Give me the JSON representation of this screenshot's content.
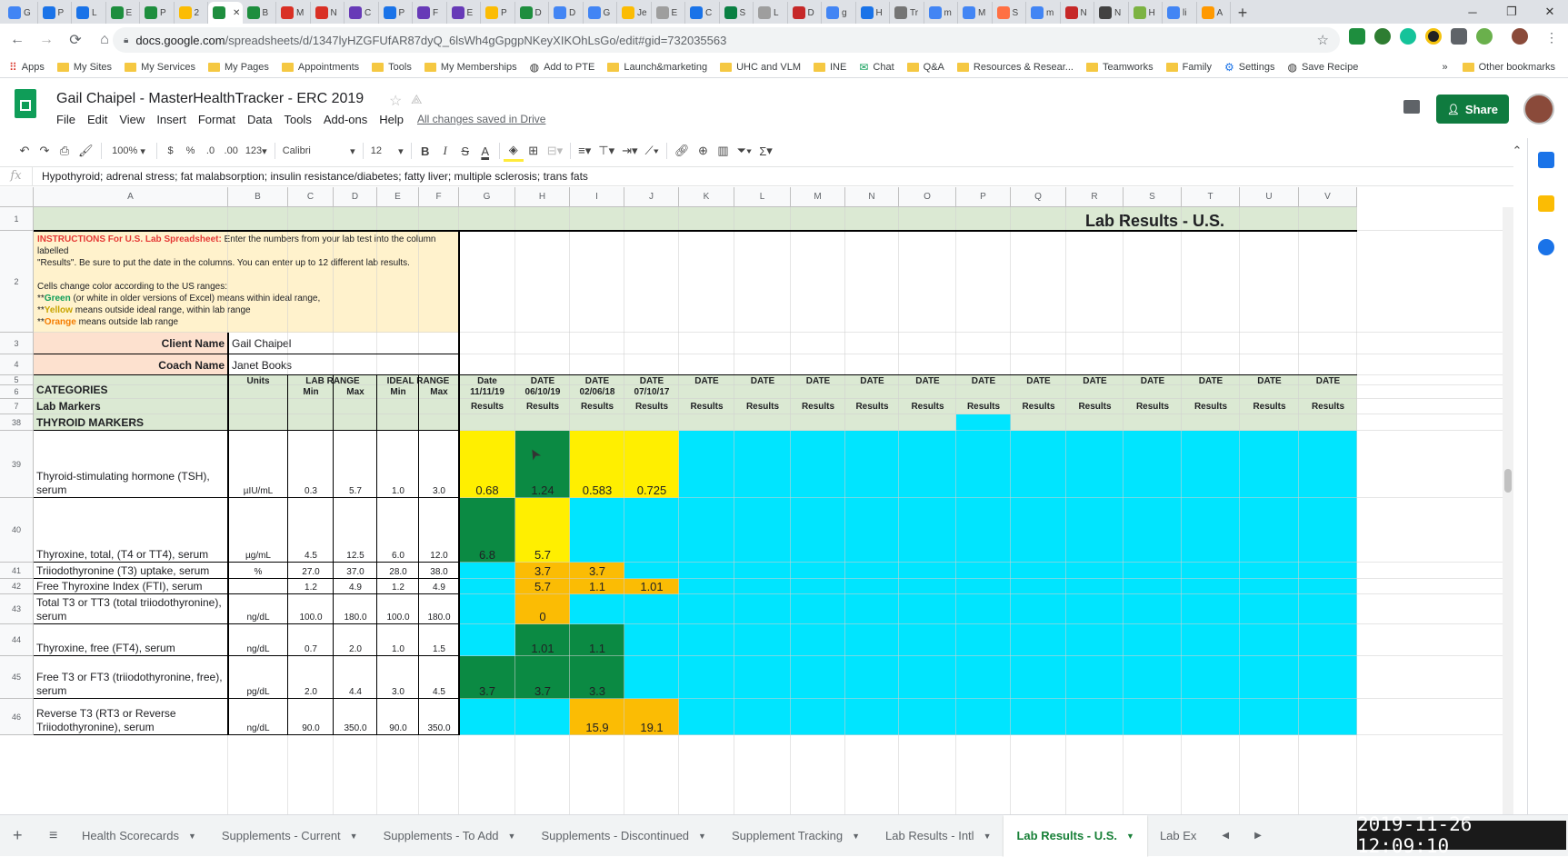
{
  "browser": {
    "tabs": [
      {
        "label": "G",
        "color": "#4285f4",
        "icon": "calendar-icon"
      },
      {
        "label": "P",
        "color": "#1a73e8",
        "icon": "meet-icon"
      },
      {
        "label": "L",
        "color": "#1a73e8",
        "icon": "meet-icon"
      },
      {
        "label": "E",
        "color": "#1e8e3e",
        "icon": "sheets-icon"
      },
      {
        "label": "P",
        "color": "#1e8e3e",
        "icon": "sheets-icon"
      },
      {
        "label": "2",
        "color": "#fbbc04",
        "icon": "drive-icon"
      },
      {
        "label": "",
        "color": "#1e8e3e",
        "icon": "sheets-icon",
        "active": true
      },
      {
        "label": "B",
        "color": "#1e8e3e",
        "icon": "sheets-icon"
      },
      {
        "label": "M",
        "color": "#d93025",
        "icon": "pdf-icon"
      },
      {
        "label": "N",
        "color": "#d93025",
        "icon": "pdf-icon"
      },
      {
        "label": "C",
        "color": "#673ab7",
        "icon": "forms-icon"
      },
      {
        "label": "P",
        "color": "#1a73e8",
        "icon": "meet-icon"
      },
      {
        "label": "F",
        "color": "#673ab7",
        "icon": "forms-icon"
      },
      {
        "label": "E",
        "color": "#673ab7",
        "icon": "forms-icon"
      },
      {
        "label": "P",
        "color": "#fbbc04",
        "icon": "drive-icon"
      },
      {
        "label": "D",
        "color": "#1e8e3e",
        "icon": "sheets-icon"
      },
      {
        "label": "D",
        "color": "#4285f4",
        "icon": "docs-icon"
      },
      {
        "label": "G",
        "color": "#4285f4",
        "icon": "calendar-icon"
      },
      {
        "label": "Je",
        "color": "#fbbc04",
        "icon": "drive-icon"
      },
      {
        "label": "E",
        "color": "#9e9e9e",
        "icon": "image-icon"
      },
      {
        "label": "C",
        "color": "#1a73e8",
        "icon": "link-icon"
      },
      {
        "label": "S",
        "color": "#0a8043",
        "icon": "k-icon"
      },
      {
        "label": "L",
        "color": "#9e9e9e",
        "icon": "image-icon"
      },
      {
        "label": "D",
        "color": "#c62828",
        "icon": "bars-icon"
      },
      {
        "label": "g",
        "color": "#4285f4",
        "icon": "google-icon"
      },
      {
        "label": "H",
        "color": "#1a73e8",
        "icon": "moon-icon"
      },
      {
        "label": "Tr",
        "color": "#757575",
        "icon": "hand-icon"
      },
      {
        "label": "m",
        "color": "#4285f4",
        "icon": "google-icon"
      },
      {
        "label": "M",
        "color": "#4285f4",
        "icon": "google-icon"
      },
      {
        "label": "S",
        "color": "#ff7043",
        "icon": "e-icon"
      },
      {
        "label": "m",
        "color": "#4285f4",
        "icon": "google-icon"
      },
      {
        "label": "N",
        "color": "#c62828",
        "icon": "image-icon"
      },
      {
        "label": "N",
        "color": "#424242",
        "icon": "circle-icon"
      },
      {
        "label": "H",
        "color": "#7cb342",
        "icon": "sheet-icon"
      },
      {
        "label": "li",
        "color": "#4285f4",
        "icon": "google-icon"
      },
      {
        "label": "A",
        "color": "#ff9900",
        "icon": "amazon-icon"
      }
    ],
    "new_tab": "+",
    "minimize": "─",
    "maximize": "❐",
    "close": "✕",
    "url_host": "docs.google.com",
    "url_path": "/spreadsheets/d/1347lyHZGFUfAR87dyQ_6lsWh4gGpgpNKeyXIKOhLsGo/edit#gid=732035563",
    "bookmarks": [
      {
        "label": "Apps",
        "icon": "apps-icon"
      },
      {
        "label": "My Sites",
        "icon": "folder-icon"
      },
      {
        "label": "My Services",
        "icon": "folder-icon"
      },
      {
        "label": "My Pages",
        "icon": "folder-icon"
      },
      {
        "label": "Appointments",
        "icon": "folder-icon"
      },
      {
        "label": "Tools",
        "icon": "folder-icon"
      },
      {
        "label": "My Memberships",
        "icon": "folder-icon"
      },
      {
        "label": "Add to PTE",
        "icon": "globe-icon"
      },
      {
        "label": "Launch&marketing",
        "icon": "folder-icon"
      },
      {
        "label": "UHC and VLM",
        "icon": "folder-icon"
      },
      {
        "label": "INE",
        "icon": "folder-icon"
      },
      {
        "label": "Chat",
        "icon": "chat-icon"
      },
      {
        "label": "Q&A",
        "icon": "folder-icon"
      },
      {
        "label": "Resources & Resear...",
        "icon": "folder-icon"
      },
      {
        "label": "Teamworks",
        "icon": "folder-icon"
      },
      {
        "label": "Family",
        "icon": "folder-icon"
      },
      {
        "label": "Settings",
        "icon": "gear-icon"
      },
      {
        "label": "Save Recipe",
        "icon": "globe-icon"
      }
    ],
    "bookmarks_more": "»",
    "other_bookmarks": "Other bookmarks"
  },
  "sheets": {
    "title": "Gail Chaipel - MasterHealthTracker  - ERC 2019",
    "menu": [
      "File",
      "Edit",
      "View",
      "Insert",
      "Format",
      "Data",
      "Tools",
      "Add-ons",
      "Help"
    ],
    "saved_status": "All changes saved in Drive",
    "share_label": "Share",
    "toolbar": {
      "zoom": "100%",
      "currency": "$",
      "percent": "%",
      "dec_less": ".0",
      "dec_more": ".00",
      "format_more": "123",
      "font": "Calibri",
      "font_size": "12",
      "bold": "B",
      "italic": "I",
      "strike": "S",
      "text_color": "A",
      "sigma": "Σ"
    },
    "formula_content": "Hypothyroid; adrenal stress; fat malabsorption; insulin resistance/diabetes; fatty liver; multiple sclerosis; trans fats"
  },
  "grid": {
    "columns": [
      "A",
      "B",
      "C",
      "D",
      "E",
      "F",
      "G",
      "H",
      "I",
      "J",
      "K",
      "L",
      "M",
      "N",
      "O",
      "P",
      "Q",
      "R",
      "S",
      "T",
      "U",
      "V"
    ],
    "row_numbers": [
      "1",
      "2",
      "3",
      "4",
      "5",
      "6",
      "7",
      "38",
      "39",
      "40",
      "41",
      "42",
      "43",
      "44",
      "45",
      "46"
    ],
    "sheet_title": "Lab Results - U.S.",
    "instructions": {
      "heading": "INSTRUCTIONS For U.S. Lab Spreadsheet:",
      "line1_rest": " Enter the numbers from your lab test into the column labelled",
      "line2": "\"Results\".  Be sure to put the date in the columns.  You can enter up to 12 different lab results.",
      "line3": "Cells change color according to the US ranges:",
      "green_prefix": "**",
      "green_word": "Green",
      "green_rest": " (or white in older versions of Excel) means within ideal range,",
      "yellow_prefix": "**",
      "yellow_word": "Yellow",
      "yellow_rest": " means outside ideal range, within lab range",
      "orange_prefix": "**",
      "orange_word": "Orange",
      "orange_rest": " means outside lab range"
    },
    "client_label": "Client Name",
    "client_value": "Gail Chaipel",
    "coach_label": "Coach Name",
    "coach_value": "Janet Books",
    "units_header": "Units",
    "lab_range_header": "LAB RANGE",
    "ideal_range_header": "IDEAL RANGE",
    "min_label": "Min",
    "max_label": "Max",
    "categories_label": "CATEGORIES",
    "lab_markers_label": "Lab Markers",
    "date_headers": [
      "Date",
      "DATE",
      "DATE",
      "DATE",
      "DATE",
      "DATE",
      "DATE",
      "DATE",
      "DATE",
      "DATE",
      "DATE",
      "DATE",
      "DATE",
      "DATE",
      "DATE",
      "DATE"
    ],
    "dates": [
      "11/11/19",
      "06/10/19",
      "02/06/18",
      "07/10/17"
    ],
    "results_label": "Results",
    "section_thyroid": "THYROID MARKERS",
    "markers": [
      {
        "row": "39",
        "name1": "Thyroid-stimulating hormone (TSH),",
        "name2": "serum",
        "units": "µIU/mL",
        "lab_min": "0.3",
        "lab_max": "5.7",
        "ideal_min": "1.0",
        "ideal_max": "3.0",
        "results": [
          "0.68",
          "1.24",
          "0.583",
          "0.725"
        ],
        "colors": [
          "#ffef00",
          "#0b8a43",
          "#ffef00",
          "#ffef00"
        ]
      },
      {
        "row": "40",
        "name1": "Thyroxine, total, (T4  or TT4), serum",
        "name2": "",
        "units": "µg/mL",
        "lab_min": "4.5",
        "lab_max": "12.5",
        "ideal_min": "6.0",
        "ideal_max": "12.0",
        "results": [
          "6.8",
          "5.7",
          "",
          ""
        ],
        "colors": [
          "#0b8a43",
          "#ffef00",
          "",
          ""
        ]
      },
      {
        "row": "41",
        "name1": "Triiodothyronine (T3) uptake, serum",
        "name2": "",
        "units": "%",
        "lab_min": "27.0",
        "lab_max": "37.0",
        "ideal_min": "28.0",
        "ideal_max": "38.0",
        "results": [
          "",
          "3.7",
          "3.7",
          ""
        ],
        "colors": [
          "",
          "#fbbc04",
          "#fbbc04",
          ""
        ]
      },
      {
        "row": "42",
        "name1": "Free Thyroxine Index (FTI), serum",
        "name2": "",
        "units": "",
        "lab_min": "1.2",
        "lab_max": "4.9",
        "ideal_min": "1.2",
        "ideal_max": "4.9",
        "results": [
          "",
          "5.7",
          "1.1",
          "1.01"
        ],
        "colors": [
          "",
          "#fbbc04",
          "#fbbc04",
          "#fbbc04"
        ]
      },
      {
        "row": "43",
        "name1": "Total T3 or TT3 (total triiodothyronine),",
        "name2": "serum",
        "units": "ng/dL",
        "lab_min": "100.0",
        "lab_max": "180.0",
        "ideal_min": "100.0",
        "ideal_max": "180.0",
        "results": [
          "",
          "0",
          "",
          ""
        ],
        "colors": [
          "",
          "#fbbc04",
          "",
          ""
        ]
      },
      {
        "row": "44",
        "name1": "Thyroxine, free (FT4), serum",
        "name2": "",
        "units": "ng/dL",
        "lab_min": "0.7",
        "lab_max": "2.0",
        "ideal_min": "1.0",
        "ideal_max": "1.5",
        "results": [
          "",
          "1.01",
          "1.1",
          ""
        ],
        "colors": [
          "",
          "#0b8a43",
          "#0b8a43",
          ""
        ]
      },
      {
        "row": "45",
        "name1": "Free T3 or FT3 (triiodothyronine, free),",
        "name2": "serum",
        "units": "pg/dL",
        "lab_min": "2.0",
        "lab_max": "4.4",
        "ideal_min": "3.0",
        "ideal_max": "4.5",
        "results": [
          "3.7",
          "3.7",
          "3.3",
          ""
        ],
        "colors": [
          "#0b8a43",
          "#0b8a43",
          "#0b8a43",
          ""
        ]
      },
      {
        "row": "46",
        "name1": "Reverse T3 (RT3 or Reverse",
        "name2": "Triiodothyronine), serum",
        "units": "ng/dL",
        "lab_min": "90.0",
        "lab_max": "350.0",
        "ideal_min": "90.0",
        "ideal_max": "350.0",
        "results": [
          "",
          "",
          "15.9",
          "19.1"
        ],
        "colors": [
          "",
          "",
          "#fbbc04",
          "#fbbc04"
        ]
      }
    ],
    "fill_color_cyan": "#00e5ff",
    "fill_color_peach": "#fde1cf",
    "fill_color_cream": "#fff2cc",
    "fill_color_sage": "#dbe9d3"
  },
  "sheet_tabs": {
    "add": "+",
    "list": "≡",
    "tabs": [
      "Health Scorecards",
      "Supplements - Current",
      "Supplements - To Add",
      "Supplements - Discontinued",
      "Supplement Tracking",
      "Lab Results - Intl",
      "Lab Results - U.S.",
      "Lab Ex"
    ],
    "active_index": 6,
    "prev": "◀",
    "next": "▶"
  },
  "clock": "2019-11-26  12:09:10"
}
